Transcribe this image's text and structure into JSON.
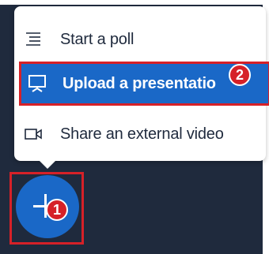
{
  "menu": {
    "items": [
      {
        "label": "Start a poll",
        "icon": "poll-list-icon"
      },
      {
        "label": "Upload a presentatio",
        "icon": "presentation-icon"
      },
      {
        "label": "Share an external video",
        "icon": "video-camera-icon"
      }
    ]
  },
  "annotations": {
    "badge_1": "1",
    "badge_2": "2"
  },
  "fab": {
    "icon": "plus-icon"
  },
  "colors": {
    "accent_blue": "#1a68c7",
    "highlight_red": "#d62128",
    "dark_background": "#1f2a3d"
  }
}
